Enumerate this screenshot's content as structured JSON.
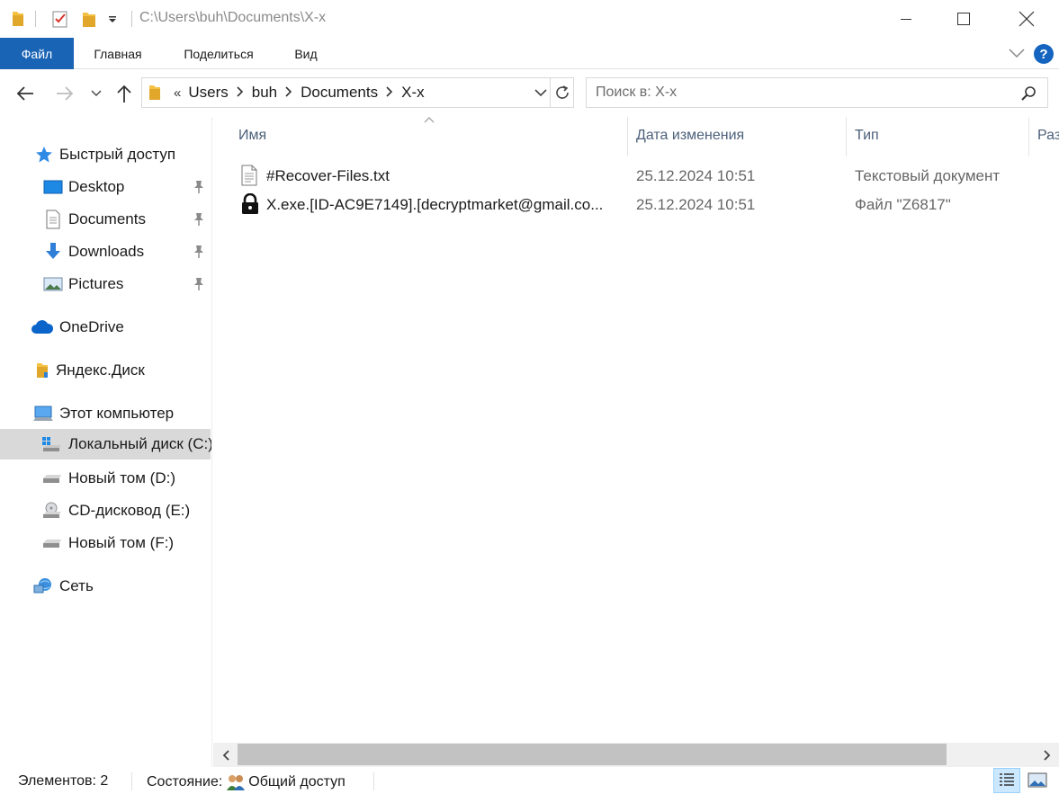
{
  "titlebar": {
    "path": "C:\\Users\\buh\\Documents\\X-x",
    "qa_icons": [
      "folder-icon",
      "properties-icon",
      "new-folder-icon",
      "customize-qa-icon"
    ]
  },
  "ribbon": {
    "tabs": [
      "Файл",
      "Главная",
      "Поделиться",
      "Вид"
    ]
  },
  "nav": {
    "breadcrumb_overflow": "«",
    "breadcrumbs": [
      "Users",
      "buh",
      "Documents",
      "X-x"
    ],
    "search_placeholder": "Поиск в: X-x"
  },
  "sidebar": {
    "quick_access": "Быстрый доступ",
    "quick_items": [
      "Desktop",
      "Documents",
      "Downloads",
      "Pictures"
    ],
    "onedrive": "OneDrive",
    "yandex": "Яндекс.Диск",
    "this_pc": "Этот компьютер",
    "drives": [
      "Локальный диск (C:)",
      "Новый том (D:)",
      "CD-дисковод (E:)",
      "Новый том (F:)"
    ],
    "network": "Сеть"
  },
  "columns": [
    "Имя",
    "Дата изменения",
    "Тип",
    "Раз"
  ],
  "files": [
    {
      "name": "#Recover-Files.txt",
      "date": "25.12.2024 10:51",
      "type": "Текстовый документ",
      "icon": "text-file-icon"
    },
    {
      "name": "X.exe.[ID-AC9E7149].[decryptmarket@gmail.co...",
      "date": "25.12.2024 10:51",
      "type": "Файл \"Z6817\"",
      "icon": "lock-icon"
    }
  ],
  "status": {
    "items": "Элементов: 2",
    "state_label": "Состояние:",
    "state_value": "Общий доступ"
  },
  "colors": {
    "accent": "#1a64b5",
    "selection": "#d9d9d9",
    "header_text": "#4c607a"
  }
}
